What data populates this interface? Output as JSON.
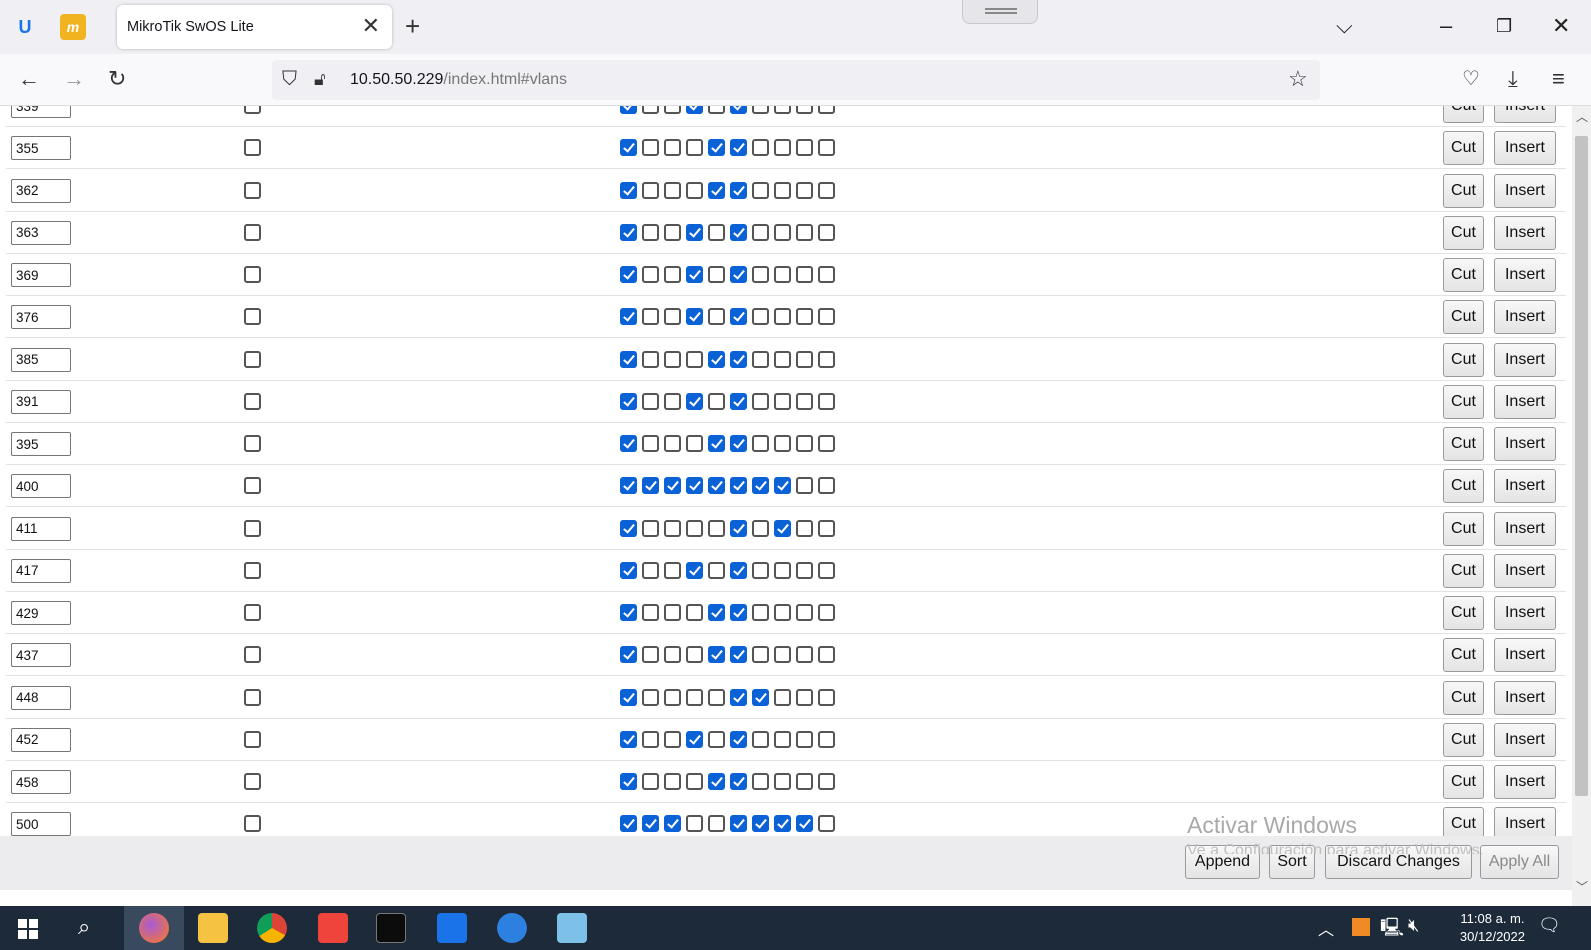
{
  "browser": {
    "tab_title": "MikroTik SwOS Lite",
    "url_host": "10.50.50.229",
    "url_path": "/index.html#vlans"
  },
  "vlan_rows": [
    {
      "id": "339",
      "ports": [
        1,
        0,
        0,
        1,
        0,
        1,
        0,
        0,
        0,
        0
      ]
    },
    {
      "id": "355",
      "ports": [
        1,
        0,
        0,
        0,
        1,
        1,
        0,
        0,
        0,
        0
      ]
    },
    {
      "id": "362",
      "ports": [
        1,
        0,
        0,
        0,
        1,
        1,
        0,
        0,
        0,
        0
      ]
    },
    {
      "id": "363",
      "ports": [
        1,
        0,
        0,
        1,
        0,
        1,
        0,
        0,
        0,
        0
      ]
    },
    {
      "id": "369",
      "ports": [
        1,
        0,
        0,
        1,
        0,
        1,
        0,
        0,
        0,
        0
      ]
    },
    {
      "id": "376",
      "ports": [
        1,
        0,
        0,
        1,
        0,
        1,
        0,
        0,
        0,
        0
      ]
    },
    {
      "id": "385",
      "ports": [
        1,
        0,
        0,
        0,
        1,
        1,
        0,
        0,
        0,
        0
      ]
    },
    {
      "id": "391",
      "ports": [
        1,
        0,
        0,
        1,
        0,
        1,
        0,
        0,
        0,
        0
      ]
    },
    {
      "id": "395",
      "ports": [
        1,
        0,
        0,
        0,
        1,
        1,
        0,
        0,
        0,
        0
      ]
    },
    {
      "id": "400",
      "ports": [
        1,
        1,
        1,
        1,
        1,
        1,
        1,
        1,
        0,
        0
      ]
    },
    {
      "id": "411",
      "ports": [
        1,
        0,
        0,
        0,
        0,
        1,
        0,
        1,
        0,
        0
      ]
    },
    {
      "id": "417",
      "ports": [
        1,
        0,
        0,
        1,
        0,
        1,
        0,
        0,
        0,
        0
      ]
    },
    {
      "id": "429",
      "ports": [
        1,
        0,
        0,
        0,
        1,
        1,
        0,
        0,
        0,
        0
      ]
    },
    {
      "id": "437",
      "ports": [
        1,
        0,
        0,
        0,
        1,
        1,
        0,
        0,
        0,
        0
      ]
    },
    {
      "id": "448",
      "ports": [
        1,
        0,
        0,
        0,
        0,
        1,
        1,
        0,
        0,
        0
      ]
    },
    {
      "id": "452",
      "ports": [
        1,
        0,
        0,
        1,
        0,
        1,
        0,
        0,
        0,
        0
      ]
    },
    {
      "id": "458",
      "ports": [
        1,
        0,
        0,
        0,
        1,
        1,
        0,
        0,
        0,
        0
      ]
    },
    {
      "id": "500",
      "ports": [
        1,
        1,
        1,
        0,
        0,
        1,
        1,
        1,
        1,
        0
      ]
    }
  ],
  "row_buttons": {
    "cut": "Cut",
    "insert": "Insert"
  },
  "footer": {
    "append": "Append",
    "sort": "Sort",
    "discard": "Discard Changes",
    "apply": "Apply All"
  },
  "watermark": {
    "title": "Activar Windows",
    "subtitle": "Ve a Configuración para activar Windows."
  },
  "taskbar": {
    "time": "11:08 a. m.",
    "date": "30/12/2022"
  },
  "colors": {
    "checkbox_checked": "#0b62d6",
    "taskbar": "#1c2a3a"
  },
  "icons": [
    "windows-start-icon",
    "search-icon",
    "firefox-icon",
    "file-explorer-icon",
    "chrome-icon",
    "anydesk-icon",
    "terminal-icon",
    "unifi-icon",
    "app-icon",
    "notepad-icon"
  ]
}
